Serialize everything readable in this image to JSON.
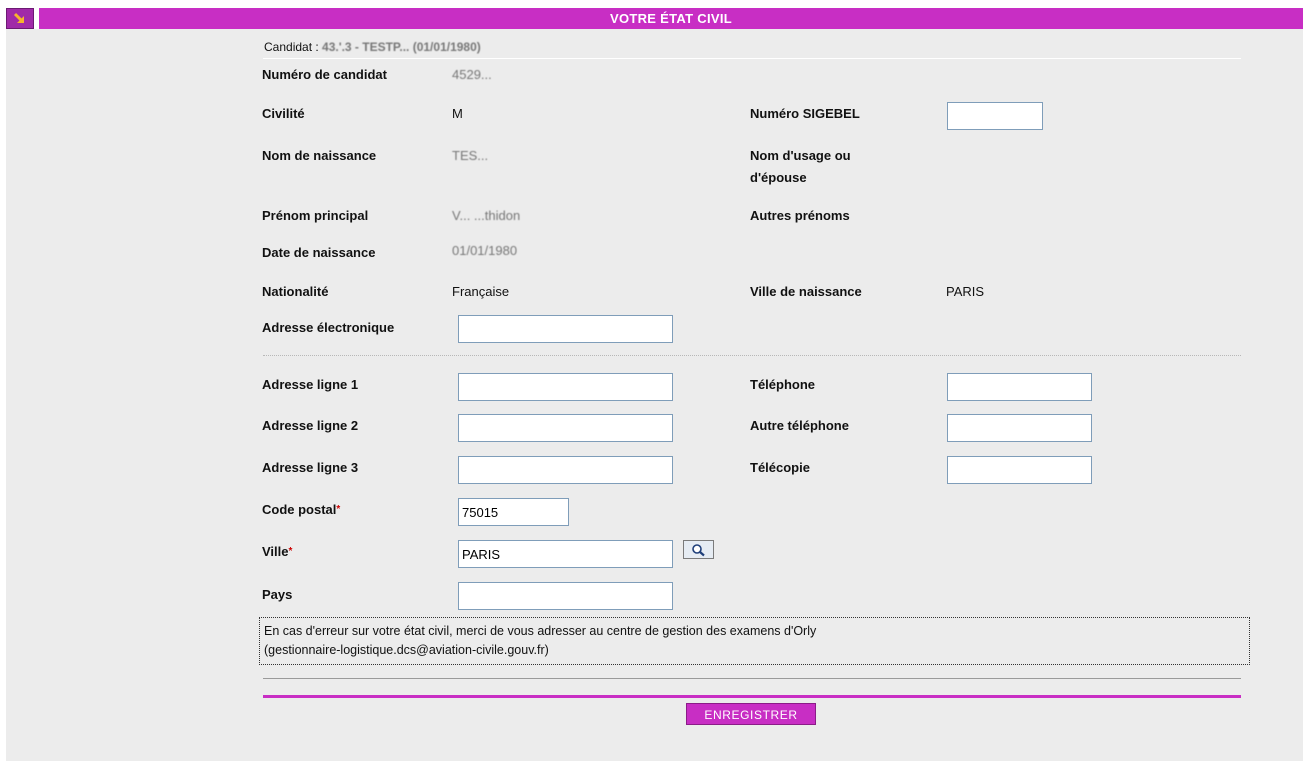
{
  "header": {
    "title": "VOTRE ÉTAT CIVIL",
    "corner_icon": "arrow-down-right-icon"
  },
  "candidate": {
    "prefix": "Candidat :",
    "value": "43.'.3 - TESTP... (01/01/1980)"
  },
  "fields": {
    "numero_candidat": {
      "label": "Numéro de candidat",
      "value": "4529..."
    },
    "civilite": {
      "label": "Civilité",
      "value": "M"
    },
    "numero_sigebel": {
      "label": "Numéro SIGEBEL",
      "value": ""
    },
    "nom_naissance": {
      "label": "Nom de naissance",
      "value": "TES..."
    },
    "nom_usage": {
      "label": "Nom d'usage ou d'épouse",
      "value": ""
    },
    "prenom_principal": {
      "label": "Prénom principal",
      "value": "V... ...thidon"
    },
    "autres_prenoms": {
      "label": "Autres prénoms",
      "value": ""
    },
    "date_naissance": {
      "label": "Date de naissance",
      "value": "01/01/1980"
    },
    "nationalite": {
      "label": "Nationalité",
      "value": "Française"
    },
    "ville_naissance": {
      "label": "Ville de naissance",
      "value": "PARIS"
    },
    "adresse_electronique": {
      "label": "Adresse électronique",
      "value": ""
    },
    "adresse1": {
      "label": "Adresse ligne 1",
      "value": ""
    },
    "adresse2": {
      "label": "Adresse ligne 2",
      "value": ""
    },
    "adresse3": {
      "label": "Adresse ligne 3",
      "value": ""
    },
    "telephone": {
      "label": "Téléphone",
      "value": ""
    },
    "autre_telephone": {
      "label": "Autre téléphone",
      "value": ""
    },
    "telecopie": {
      "label": "Télécopie",
      "value": ""
    },
    "code_postal": {
      "label": "Code postal",
      "value": "75015",
      "required_mark": "*"
    },
    "ville": {
      "label": "Ville",
      "value": "PARIS",
      "required_mark": "*"
    },
    "pays": {
      "label": "Pays",
      "value": ""
    }
  },
  "info": {
    "line1": "En cas d'erreur sur votre état civil, merci de vous adresser au centre de gestion des examens d'Orly",
    "line2": "(gestionnaire-logistique.dcs@aviation-civile.gouv.fr)"
  },
  "actions": {
    "save_label": "ENREGISTRER",
    "search_icon": "magnifier-icon"
  },
  "colors": {
    "accent": "#c82ec4",
    "background": "#ececec",
    "required": "#cc0000"
  }
}
